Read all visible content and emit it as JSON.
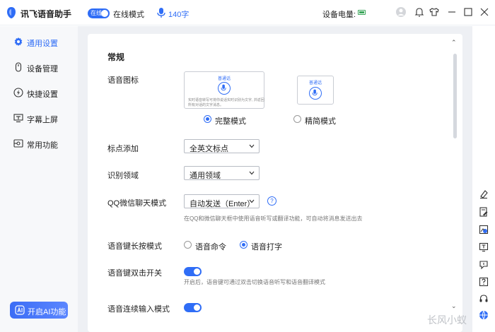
{
  "app": {
    "title": "讯飞语音助手"
  },
  "header": {
    "online_toggle_text": "在线",
    "mode_label": "在线模式",
    "word_count": "140字",
    "battery_label": "设备电量:",
    "icons": [
      "user-icon",
      "bell-icon",
      "shirt-icon",
      "minimize-icon",
      "close-icon"
    ]
  },
  "sidebar": {
    "items": [
      {
        "label": "通用设置",
        "icon": "gear-icon"
      },
      {
        "label": "设备管理",
        "icon": "mouse-icon"
      },
      {
        "label": "快捷设置",
        "icon": "lightning-icon"
      },
      {
        "label": "字幕上屏",
        "icon": "caption-icon"
      },
      {
        "label": "常用功能",
        "icon": "function-icon"
      }
    ],
    "active": "通用设置",
    "ai_button": "开启AI功能"
  },
  "settings": {
    "section_title": "常规",
    "voice_icon": {
      "label": "语音图标",
      "card_tag": "普通话",
      "card_desc": "实时语音转写可将你说话实时识别为文字, 并返回所有对话的文字消息。",
      "options": [
        "完整模式",
        "精简模式"
      ],
      "selected": "完整模式"
    },
    "punctuation": {
      "label": "标点添加",
      "value": "全英文标点"
    },
    "domain": {
      "label": "识别领域",
      "value": "通用领域"
    },
    "qq_wechat": {
      "label": "QQ微信聊天模式",
      "value": "自动发送（Enter）",
      "help": "?",
      "hint": "在QQ和微信聊天框中使用语音听写或翻译功能，可自动将消息发送出去"
    },
    "long_press": {
      "label": "语音键长按模式",
      "options": [
        "语音命令",
        "语音打字"
      ],
      "selected": "语音打字"
    },
    "double_click": {
      "label": "语音键双击开关",
      "enabled": true,
      "hint": "开启后，语音键可通过双击切换语音听写和语音翻译模式"
    },
    "continuous": {
      "label": "语音连续输入模式",
      "enabled": true
    }
  },
  "right_toolbar": [
    "eraser-icon",
    "document-edit-icon",
    "image-translate-icon",
    "text-icon",
    "chat-icon",
    "help-icon",
    "headset-icon",
    "globe-icon"
  ],
  "watermark": "长风小蚁",
  "colors": {
    "accent": "#2f6df6",
    "battery": "#3aa65a"
  }
}
